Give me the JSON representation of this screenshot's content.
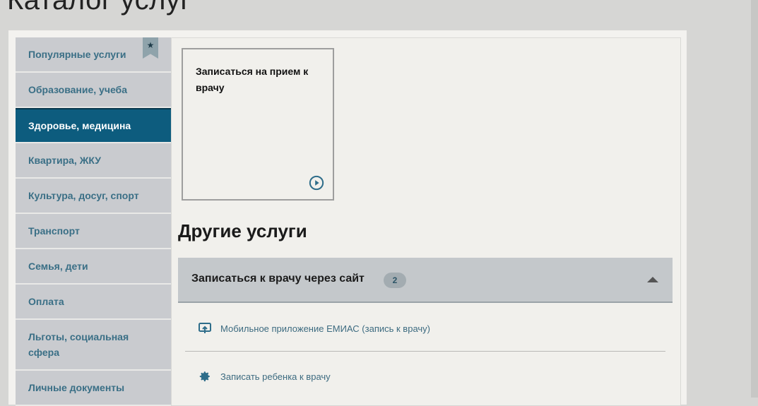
{
  "page": {
    "title": "Каталог услуг"
  },
  "sidebar": {
    "items": [
      {
        "label": "Популярные услуги",
        "active": false
      },
      {
        "label": "Образование, учеба",
        "active": false
      },
      {
        "label": "Здоровье, медицина",
        "active": true
      },
      {
        "label": "Квартира, ЖКУ",
        "active": false
      },
      {
        "label": "Культура, досуг, спорт",
        "active": false
      },
      {
        "label": "Транспорт",
        "active": false
      },
      {
        "label": "Семья, дети",
        "active": false
      },
      {
        "label": "Оплата",
        "active": false
      },
      {
        "label": "Льготы, социальная сфера",
        "active": false
      },
      {
        "label": "Личные документы",
        "active": false
      }
    ],
    "bookmark_glyph": "★"
  },
  "featured": {
    "tile_title": "Записаться на прием к врачу",
    "tile_icon": "play-circle-icon"
  },
  "other_services": {
    "heading": "Другие услуги",
    "group": {
      "title": "Записаться к врачу через сайт",
      "count": "2",
      "expanded": true
    },
    "links": [
      {
        "label": "Мобильное приложение ЕМИАС (запись к врачу)",
        "icon": "mobile-app-icon"
      },
      {
        "label": "Записать ребенка к врачу",
        "icon": "gear-icon"
      }
    ]
  },
  "colors": {
    "active_nav": "#0d5c7e",
    "nav_text": "#3a6f86",
    "nav_bg": "#c9cbcf",
    "accordion_bg": "#c4c8cb",
    "link_text": "#3d6b80"
  }
}
